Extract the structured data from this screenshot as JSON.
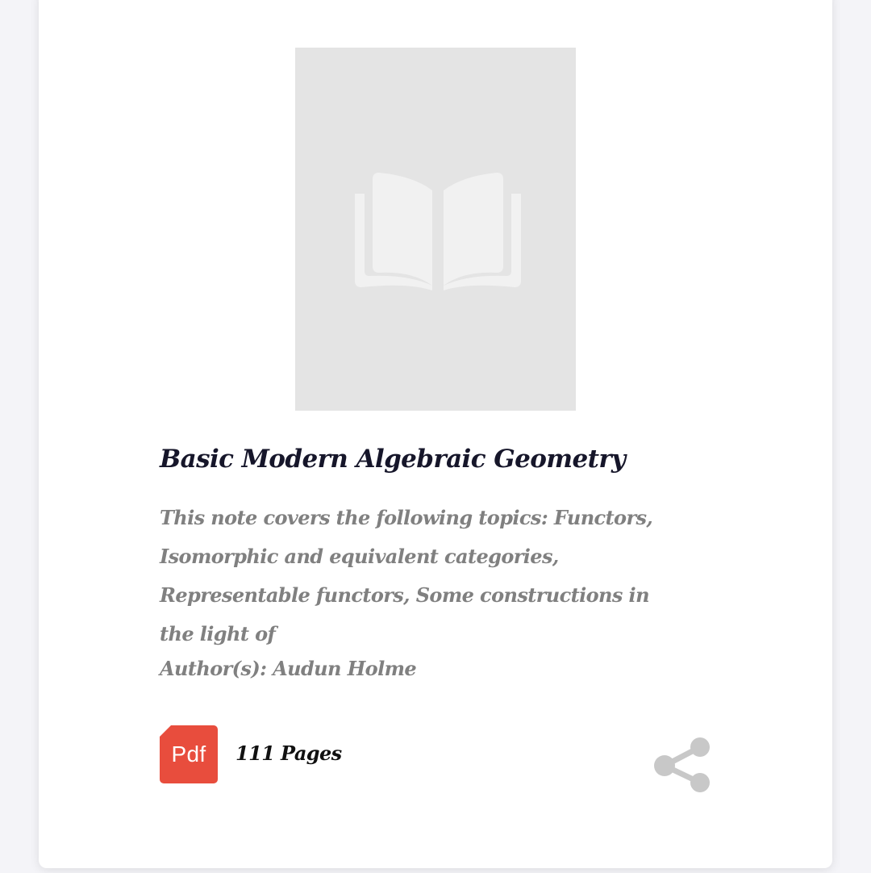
{
  "book": {
    "cover_icon": "open-book-icon",
    "title": "Basic Modern Algebraic Geometry",
    "description": "This note covers the following topics: Functors, Isomorphic and equivalent categories, Representable functors, Some constructions in the light of",
    "author": "Author(s): Audun Holme",
    "format_label": "Pdf",
    "pages": "111 Pages",
    "share_icon": "share-icon"
  },
  "colors": {
    "page_background": "#f4f4f8",
    "card_background": "#ffffff",
    "cover_placeholder": "#e4e4e4",
    "title_text": "#16162a",
    "muted_text": "#808080",
    "pdf_badge": "#e84d3d",
    "share_icon": "#c8c8c8"
  }
}
